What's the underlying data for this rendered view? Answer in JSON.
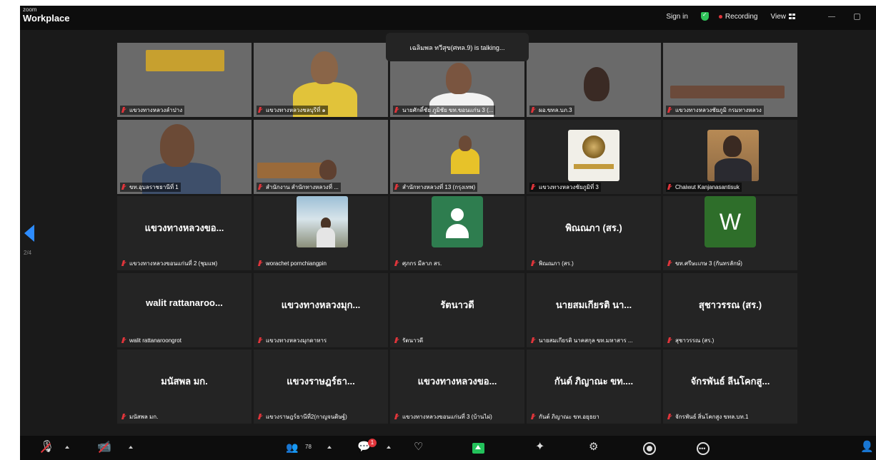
{
  "brand": {
    "line1": "zoom",
    "line2": "Workplace"
  },
  "titlebar": {
    "sign_in": "Sign in",
    "recording": "Recording",
    "view": "View"
  },
  "talking": "เฉลิมพล ทวีสุข(ศทล.9) is talking...",
  "pagination": {
    "indicator": "2/4"
  },
  "tiles": [
    {
      "label": "แขวงทางหลวงลำปาง"
    },
    {
      "label": "แขวงทางหลวงชลบุรีที่ ๑"
    },
    {
      "label": "นายศักดิ์ชัย ภูมิชัย ขท.ขอนแก่น 3 (..."
    },
    {
      "label": "ผอ.ขทล.บภ.3"
    },
    {
      "label": "แขวงทางหลวงชัยภูมิ กรมทางหลวง"
    },
    {
      "label": "ขท.อุบลราชธานีที่ 1"
    },
    {
      "label": "สำนักงาน สำนักทางหลวงที่ ..."
    },
    {
      "label": "สำนักทางหลวงที่ 13 (กรุงเทพ)"
    },
    {
      "label": "แขวงทางหลวงชัยภูมิที่ 3"
    },
    {
      "label": "Chaiwut Kanjanasantisuk"
    },
    {
      "name": "แขวงทางหลวงขอ...",
      "label": "แขวงทางหลวงขอนแก่นที่ 2 (ชุมแพ)"
    },
    {
      "label": "worachet pornchiangpin"
    },
    {
      "label": "ศุภกร มีลาภ สร."
    },
    {
      "name": "พิณณภา (สร.)",
      "label": "พิณณภา (สร.)"
    },
    {
      "avatar_letter": "W",
      "label": "ขท.ศรีษะเกษ 3 (กันทรลักษ์)"
    },
    {
      "name": "walit  rattanaroo...",
      "label": "walit rattanaroongrot"
    },
    {
      "name": "แขวงทางหลวงมุก...",
      "label": "แขวงทางหลวงมุกดาหาร"
    },
    {
      "name": "รัตนาวดี",
      "label": "รัตนาวดี"
    },
    {
      "name": "นายสมเกียรติ  นา...",
      "label": "นายสมเกียรติ นาคสกุล ขท.มหาสาร ..."
    },
    {
      "name": "สุชาวรรณ (สร.)",
      "label": "สุชาวรรณ (สร.)"
    },
    {
      "name": "มนัสพล มก.",
      "label": "มนัสพล มก."
    },
    {
      "name": "แขวงราษฎร์ธา...",
      "label": "แขวงราษฎร์ธานีที่2(กาญจนดิษฐ์)"
    },
    {
      "name": "แขวงทางหลวงขอ...",
      "label": "แขวงทางหลวงขอนแก่นที่ 3 (บ้านไผ่)"
    },
    {
      "name": "กันต์ ภิญาณะ ขท....",
      "label": "กันต์ ภิญาณะ ขท.อยุธยา"
    },
    {
      "name": "จักรพันธ์ ลีนโคกสู...",
      "label": "จักรพันธ์ สิ่นโคกสูง ขทล.บท.1"
    }
  ],
  "toolbar": {
    "participants_count": "78",
    "chat_badge": "1"
  },
  "colors": {
    "accent": "#2d8cff",
    "recording": "#e0353b",
    "secure": "#2fc35a",
    "share": "#23c25b"
  }
}
